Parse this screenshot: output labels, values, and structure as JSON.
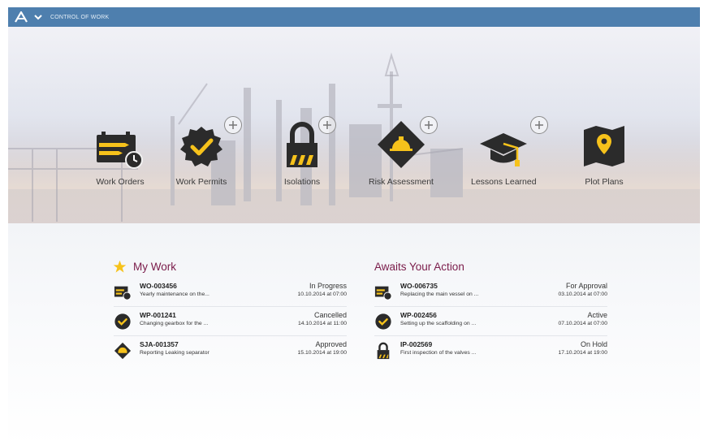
{
  "topbar": {
    "logo_icon": "atlas-logo-icon",
    "menu_icon": "chevron-down-icon",
    "title": "CONTROL OF WORK"
  },
  "tiles": [
    {
      "label": "Work Orders",
      "icon": "work-orders-icon",
      "has_add": false
    },
    {
      "label": "Work Permits",
      "icon": "work-permits-icon",
      "has_add": true
    },
    {
      "label": "Isolations",
      "icon": "isolations-icon",
      "has_add": true
    },
    {
      "label": "Risk Assessment",
      "icon": "risk-assessment-icon",
      "has_add": true
    },
    {
      "label": "Lessons Learned",
      "icon": "lessons-learned-icon",
      "has_add": true
    },
    {
      "label": "Plot Plans",
      "icon": "plot-plans-icon",
      "has_add": false
    }
  ],
  "my_work": {
    "title": "My Work",
    "icon": "star-icon",
    "items": [
      {
        "id": "WO-003456",
        "desc": "Yearly maintenance on the...",
        "status": "In Progress",
        "date": "10.10.2014 at 07:00",
        "icon": "work-order-icon"
      },
      {
        "id": "WP-001241",
        "desc": "Changing gearbox for the ...",
        "status": "Cancelled",
        "date": "14.10.2014 at 11:00",
        "icon": "work-permit-icon"
      },
      {
        "id": "SJA-001357",
        "desc": "Reporting Leaking separator",
        "status": "Approved",
        "date": "15.10.2014 at 19:00",
        "icon": "risk-assessment-icon"
      }
    ]
  },
  "awaits": {
    "title": "Awaits Your Action",
    "items": [
      {
        "id": "WO-006735",
        "desc": "Replacing the main vessel on ...",
        "status": "For Approval",
        "date": "03.10.2014 at 07:00",
        "icon": "work-order-icon"
      },
      {
        "id": "WP-002456",
        "desc": "Setting up the scaffolding on ...",
        "status": "Active",
        "date": "07.10.2014 at 07:00",
        "icon": "work-permit-icon"
      },
      {
        "id": "IP-002569",
        "desc": "First inspection of the valves ...",
        "status": "On Hold",
        "date": "17.10.2014 at 19:00",
        "icon": "isolation-icon"
      }
    ]
  },
  "colors": {
    "topbar": "#4e7fae",
    "accent_yellow": "#f6c21b",
    "icon_dark": "#2b2b2b",
    "section_title": "#7a1b4a"
  }
}
